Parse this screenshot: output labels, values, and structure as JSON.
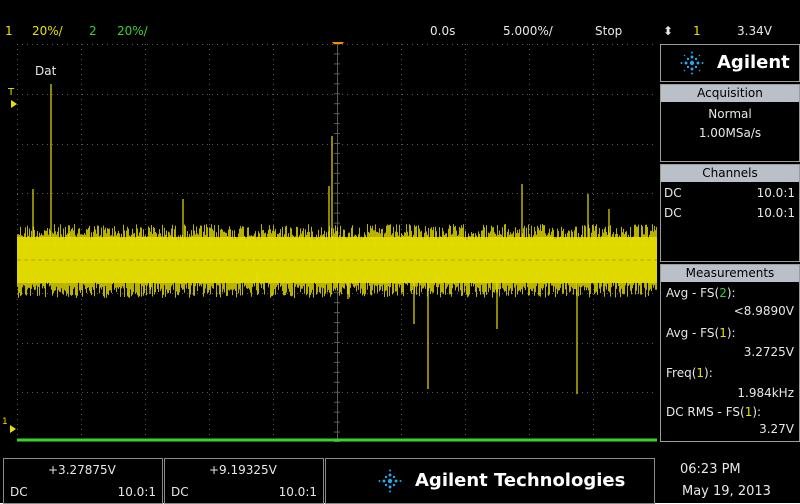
{
  "topbar": {
    "ch1_num": "1",
    "ch1_scale": "20%/",
    "ch2_num": "2",
    "ch2_scale": "20%/",
    "time_offset": "0.0s",
    "timebase": "5.000%/",
    "run_state": "Stop",
    "trigger_symbol": "⬍",
    "trigger_channel": "1",
    "trigger_level": "3.34V"
  },
  "display": {
    "ch2_label": "Dat",
    "trigger_marker": "T",
    "ground_marker": "1"
  },
  "panel": {
    "brand": "Agilent",
    "acquisition": {
      "header": "Acquisition",
      "mode": "Normal",
      "rate": "1.00MSa/s"
    },
    "channels": {
      "header": "Channels",
      "rows": [
        {
          "coupling": "DC",
          "ratio": "10.0:1"
        },
        {
          "coupling": "DC",
          "ratio": "10.0:1"
        }
      ]
    },
    "measurements": {
      "header": "Measurements",
      "items": [
        {
          "label_prefix": "Avg - FS(",
          "ch": "2",
          "label_suffix": "):",
          "value": "<8.9890V"
        },
        {
          "label_prefix": "Avg - FS(",
          "ch": "1",
          "label_suffix": "):",
          "value": "3.2725V"
        },
        {
          "label_prefix": "Freq(",
          "ch": "1",
          "label_suffix": "):",
          "value": "1.984kHz"
        },
        {
          "label_prefix": "DC RMS - FS(",
          "ch": "1",
          "label_suffix": "):",
          "value": "3.27V"
        }
      ]
    }
  },
  "bottom": {
    "ch1": {
      "value": "+3.27875V",
      "coupling": "DC",
      "ratio": "10.0:1"
    },
    "ch2": {
      "value": "+9.19325V",
      "coupling": "DC",
      "ratio": "10.0:1"
    },
    "brand": "Agilent Technologies",
    "time": "06:23 PM",
    "date": "May 19, 2013"
  },
  "colors": {
    "ch1": "#e8e000",
    "ch2": "#39d12d",
    "grid": "#5a5a5a",
    "trigger_marker": "#ff8a00"
  }
}
